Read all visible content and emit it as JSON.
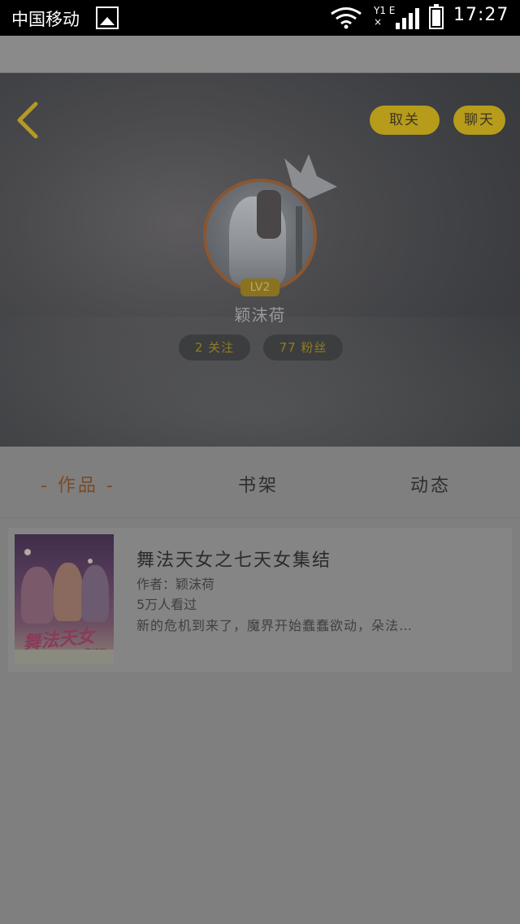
{
  "status_bar": {
    "carrier": "中国移动",
    "signal_label_top": "Y1 E",
    "signal_label_bottom": "×",
    "time": "17:27",
    "icons": [
      "gallery-icon",
      "wifi-icon",
      "signal-icon",
      "battery-icon"
    ]
  },
  "header": {
    "unfollow_label": "取关",
    "chat_label": "聊天",
    "level": "LV2",
    "nickname": "颖沫荷",
    "following": "2 关注",
    "fans": "77 粉丝",
    "accent_color": "#b69c1a"
  },
  "tabs": {
    "works": "- 作品 -",
    "shelf": "书架",
    "feed": "动态",
    "active": "works"
  },
  "books": [
    {
      "title": "舞法天女之七天女集结",
      "author": "作者：颖沫荷",
      "views": "5万人看过",
      "description": "新的危机到来了，魔界开始蠢蠢欲动，朵法…",
      "cover_title": "舞法天女",
      "cover_subtitle": "集结篇"
    }
  ]
}
